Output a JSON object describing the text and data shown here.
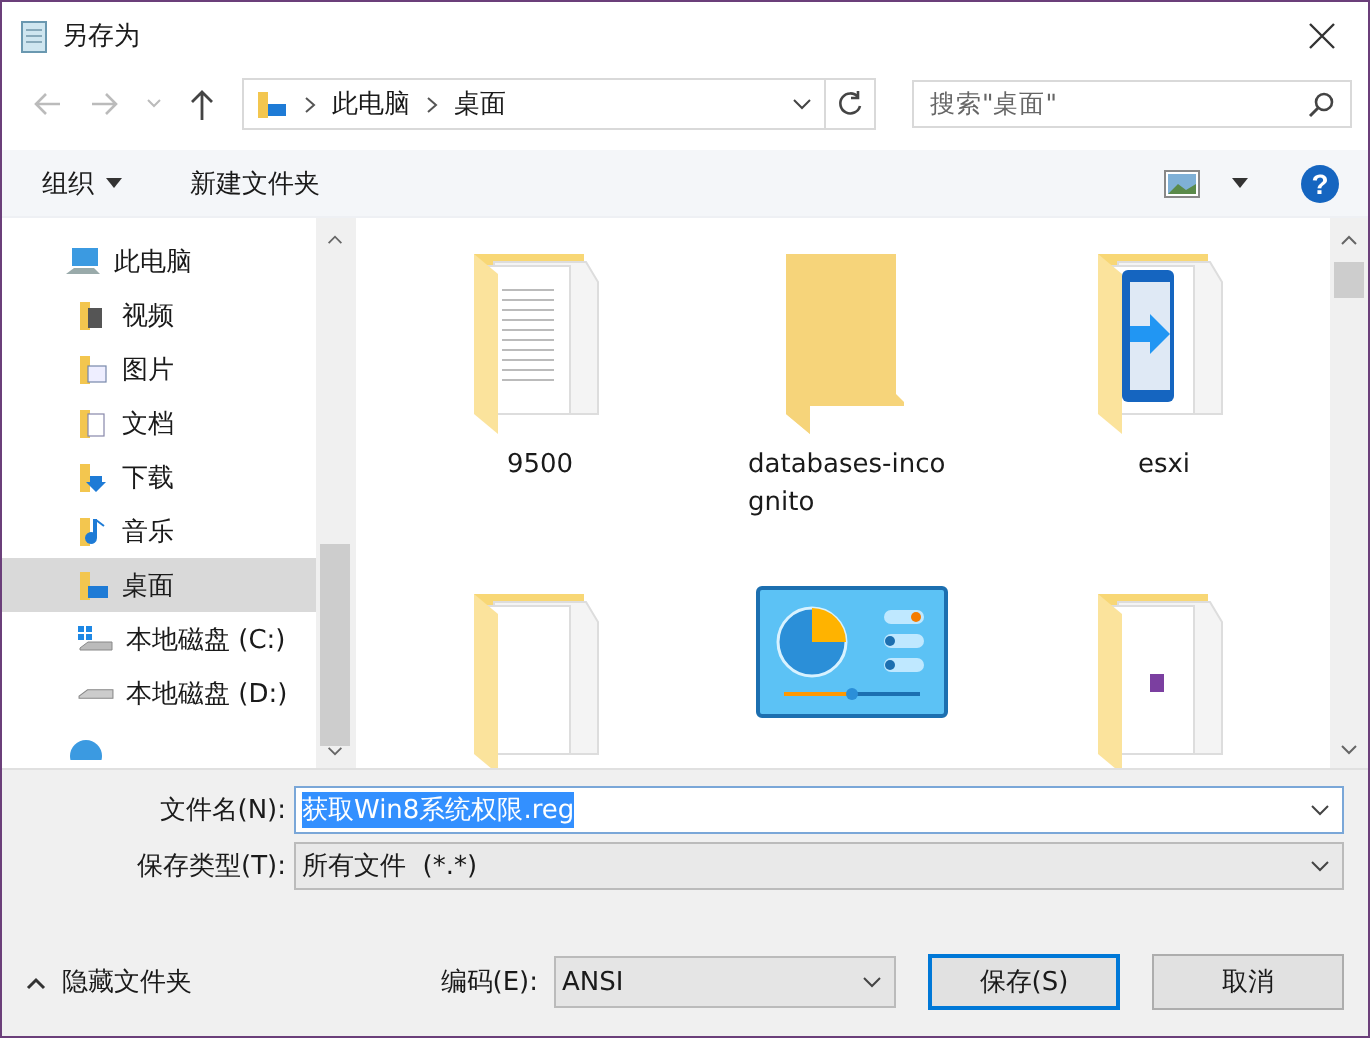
{
  "window": {
    "title": "另存为"
  },
  "nav": {
    "path": [
      "此电脑",
      "桌面"
    ],
    "search": {
      "placeholder": "搜索\"桌面\""
    }
  },
  "toolbar": {
    "organize": "组织",
    "new_folder": "新建文件夹",
    "help": "?"
  },
  "sidebar": {
    "items": [
      {
        "label": "此电脑",
        "kind": "pc",
        "selected": false,
        "children": [
          {
            "label": "视频",
            "kind": "video",
            "selected": false
          },
          {
            "label": "图片",
            "kind": "pictures",
            "selected": false
          },
          {
            "label": "文档",
            "kind": "docs",
            "selected": false
          },
          {
            "label": "下载",
            "kind": "downloads",
            "selected": false
          },
          {
            "label": "音乐",
            "kind": "music",
            "selected": false
          },
          {
            "label": "桌面",
            "kind": "desktop",
            "selected": true
          },
          {
            "label": "本地磁盘 (C:)",
            "kind": "system-drive",
            "selected": false
          },
          {
            "label": "本地磁盘 (D:)",
            "kind": "drive",
            "selected": false
          }
        ]
      }
    ]
  },
  "files": [
    {
      "name": "9500",
      "kind": "folder-docs"
    },
    {
      "name": "databases-incognito",
      "kind": "folder"
    },
    {
      "name": "esxi",
      "kind": "folder-app"
    },
    {
      "kind": "folder-pages"
    },
    {
      "kind": "control-panel"
    },
    {
      "kind": "folder-archive"
    }
  ],
  "form": {
    "filename": {
      "label": "文件名(N):",
      "value": "获取Win8系统权限.reg",
      "selected": true
    },
    "filetype": {
      "label": "保存类型(T):",
      "value": "所有文件  (*.*)"
    },
    "encoding": {
      "label": "编码(E):",
      "value": "ANSI"
    },
    "hide_folders": "隐藏文件夹",
    "save": "保存(S)",
    "cancel": "取消"
  }
}
